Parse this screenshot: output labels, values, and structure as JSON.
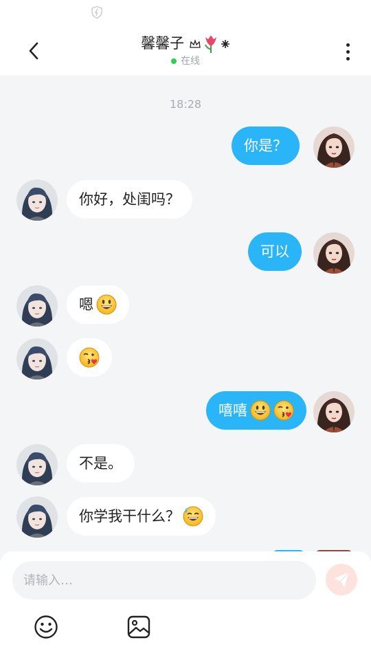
{
  "header": {
    "title": "馨馨子",
    "status": "在线",
    "back_icon": "chevron-left-icon",
    "more_icon": "more-vertical-icon"
  },
  "timestamp": "18:28",
  "messages": [
    {
      "side": "out",
      "text": "你是？",
      "emojis": []
    },
    {
      "side": "in",
      "text": "你好，处闺吗？",
      "emojis": []
    },
    {
      "side": "out",
      "text": "可以",
      "emojis": []
    },
    {
      "side": "in",
      "text": "嗯",
      "emojis": [
        "smile"
      ]
    },
    {
      "side": "in",
      "text": "",
      "emojis": [
        "kiss"
      ]
    },
    {
      "side": "out",
      "text": "嘻嘻",
      "emojis": [
        "smile",
        "kiss"
      ]
    },
    {
      "side": "in",
      "text": "不是。",
      "emojis": []
    },
    {
      "side": "in",
      "text": "你学我干什么？",
      "emojis": [
        "sweat-smile"
      ]
    }
  ],
  "composer": {
    "placeholder": "请输入…",
    "send_icon": "send-icon",
    "emoji_icon": "emoji-icon",
    "image_icon": "image-icon"
  },
  "colors": {
    "outgoing_bubble": "#29b5f7",
    "incoming_bubble": "#ffffff",
    "background": "#f4f5f7",
    "online_dot": "#2fce55"
  }
}
